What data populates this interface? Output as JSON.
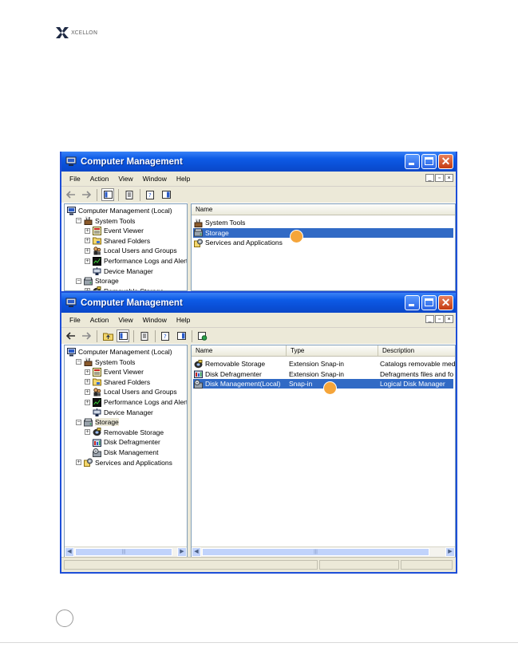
{
  "logo": {
    "text": "XCELLON",
    "colors": [
      "#1f2a44",
      "#7a7a7a"
    ]
  },
  "window1": {
    "title": "Computer Management",
    "menu": [
      "File",
      "Action",
      "View",
      "Window",
      "Help"
    ],
    "tree": [
      {
        "label": "Computer Management (Local)",
        "level": 0,
        "expander": "",
        "icon": "computer-icon"
      },
      {
        "label": "System Tools",
        "level": 1,
        "expander": "−",
        "icon": "tools-icon"
      },
      {
        "label": "Event Viewer",
        "level": 2,
        "expander": "+",
        "icon": "event-viewer-icon"
      },
      {
        "label": "Shared Folders",
        "level": 2,
        "expander": "+",
        "icon": "folder-icon"
      },
      {
        "label": "Local Users and Groups",
        "level": 2,
        "expander": "+",
        "icon": "users-icon"
      },
      {
        "label": "Performance Logs and Alerts",
        "level": 2,
        "expander": "+",
        "icon": "perf-icon"
      },
      {
        "label": "Device Manager",
        "level": 2,
        "expander": "",
        "icon": "device-icon"
      },
      {
        "label": "Storage",
        "level": 1,
        "expander": "−",
        "icon": "storage-icon"
      },
      {
        "label": "Removable Storage",
        "level": 2,
        "expander": "+",
        "icon": "removable-storage-icon"
      }
    ],
    "list_header": "Name",
    "rows": [
      {
        "name": "System Tools",
        "icon": "tools-icon",
        "selected": false
      },
      {
        "name": "Storage",
        "icon": "storage-icon",
        "selected": true
      },
      {
        "name": "Services and Applications",
        "icon": "services-icon",
        "selected": false
      }
    ]
  },
  "window2": {
    "title": "Computer Management",
    "menu": [
      "File",
      "Action",
      "View",
      "Window",
      "Help"
    ],
    "tree": [
      {
        "label": "Computer Management (Local)",
        "level": 0,
        "expander": "",
        "icon": "computer-icon",
        "selected": false
      },
      {
        "label": "System Tools",
        "level": 1,
        "expander": "−",
        "icon": "tools-icon",
        "selected": false
      },
      {
        "label": "Event Viewer",
        "level": 2,
        "expander": "+",
        "icon": "event-viewer-icon",
        "selected": false
      },
      {
        "label": "Shared Folders",
        "level": 2,
        "expander": "+",
        "icon": "folder-icon",
        "selected": false
      },
      {
        "label": "Local Users and Groups",
        "level": 2,
        "expander": "+",
        "icon": "users-icon",
        "selected": false
      },
      {
        "label": "Performance Logs and Alerts",
        "level": 2,
        "expander": "+",
        "icon": "perf-icon",
        "selected": false
      },
      {
        "label": "Device Manager",
        "level": 2,
        "expander": "",
        "icon": "device-icon",
        "selected": false
      },
      {
        "label": "Storage",
        "level": 1,
        "expander": "−",
        "icon": "storage-icon",
        "selected": true
      },
      {
        "label": "Removable Storage",
        "level": 2,
        "expander": "+",
        "icon": "removable-storage-icon",
        "selected": false
      },
      {
        "label": "Disk Defragmenter",
        "level": 2,
        "expander": "",
        "icon": "defrag-icon",
        "selected": false
      },
      {
        "label": "Disk Management",
        "level": 2,
        "expander": "",
        "icon": "disk-management-icon",
        "selected": false
      },
      {
        "label": "Services and Applications",
        "level": 1,
        "expander": "+",
        "icon": "services-icon",
        "selected": false
      }
    ],
    "columns": [
      "Name",
      "Type",
      "Description"
    ],
    "rows": [
      {
        "name": "Removable Storage",
        "type": "Extension Snap-in",
        "description": "Catalogs removable med",
        "icon": "removable-storage-icon",
        "selected": false
      },
      {
        "name": "Disk Defragmenter",
        "type": "Extension Snap-in",
        "description": "Defragments files and fo",
        "icon": "defrag-icon",
        "selected": false
      },
      {
        "name": "Disk Management(Local)",
        "type": "Snap-in",
        "description": "Logical Disk Manager",
        "icon": "disk-management-icon",
        "selected": true
      }
    ]
  },
  "colors": {
    "titlebar": "#0a4fd6",
    "selection": "#316ac5",
    "marker": "#f5a53a",
    "face": "#ece9d8"
  }
}
